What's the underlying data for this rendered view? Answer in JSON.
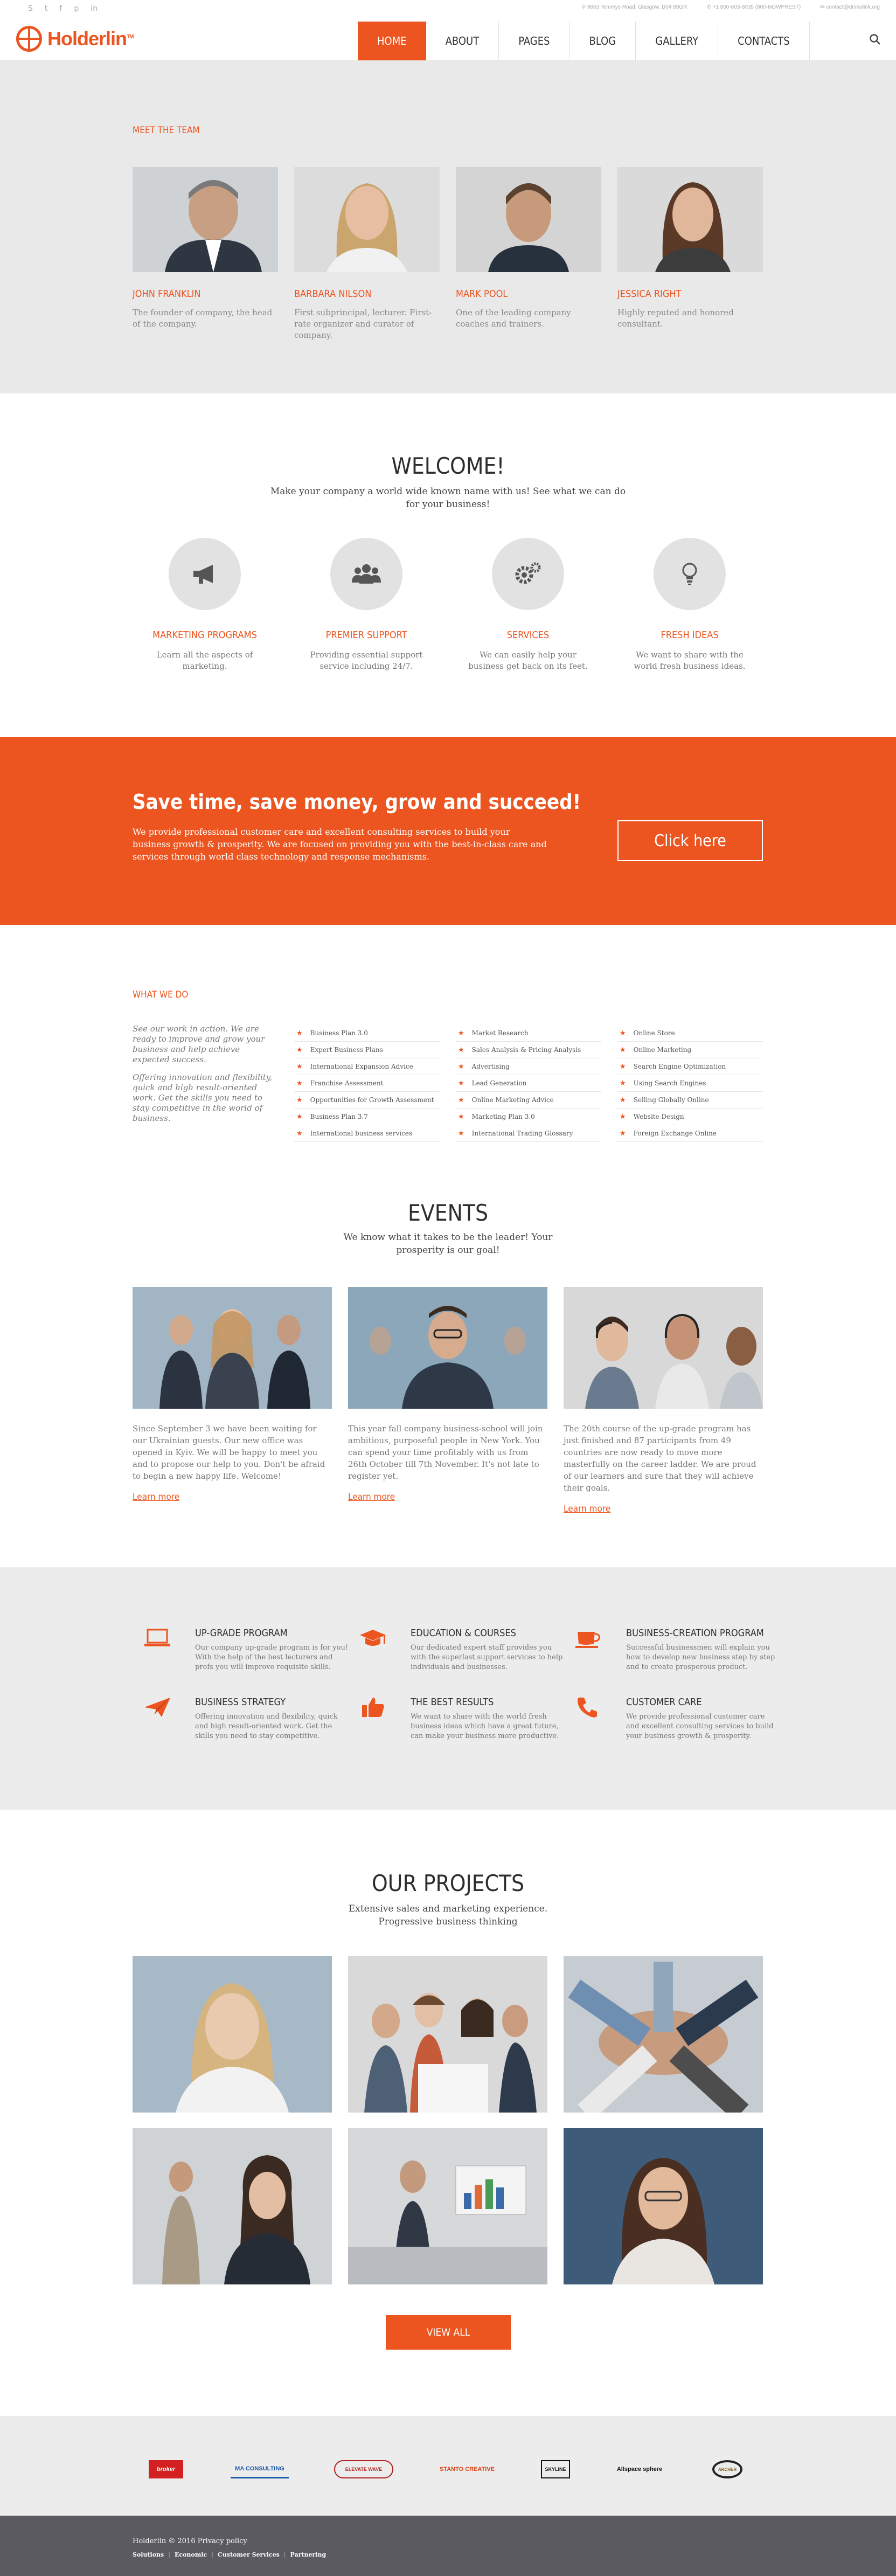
{
  "header": {
    "logo_text": "Holderlin",
    "logo_tm": "TM",
    "social_icons": [
      "skype-icon",
      "twitter-icon",
      "facebook-icon",
      "pinterest-icon",
      "linkedin-icon"
    ],
    "address": "9863 Temmys Road, Glasgow, D04 89GR",
    "phone": "+1 800-603-6035 (800-NOWPREST)",
    "email": "contact@demolink.org",
    "nav": [
      {
        "label": "HOME",
        "active": true
      },
      {
        "label": "ABOUT",
        "active": false
      },
      {
        "label": "PAGES",
        "active": false
      },
      {
        "label": "BLOG",
        "active": false
      },
      {
        "label": "GALLERY",
        "active": false
      },
      {
        "label": "CONTACTS",
        "active": false
      }
    ]
  },
  "team": {
    "label": "MEET THE TEAM",
    "members": [
      {
        "name": "JOHN FRANKLIN",
        "desc": "The founder of company, the head of the company."
      },
      {
        "name": "BARBARA NILSON",
        "desc": "First subprincipal, lecturer. First-rate organizer and curator of company."
      },
      {
        "name": "MARK POOL",
        "desc": "One of the leading company coaches and trainers."
      },
      {
        "name": "JESSICA RIGHT",
        "desc": "Highly reputed and honored consultant."
      }
    ]
  },
  "welcome": {
    "title": "WELCOME!",
    "subtitle": "Make your company a world wide known name with us! See what we can do for your business!",
    "features": [
      {
        "icon": "megaphone-icon",
        "title": "MARKETING PROGRAMS",
        "desc": "Learn all the aspects of marketing."
      },
      {
        "icon": "users-icon",
        "title": "PREMIER SUPPORT",
        "desc": "Providing essential support service including 24/7."
      },
      {
        "icon": "gears-icon",
        "title": "SERVICES",
        "desc": "We can easily help your business get back on its feet."
      },
      {
        "icon": "lightbulb-icon",
        "title": "FRESH IDEAS",
        "desc": "We want to share with the world fresh business ideas."
      }
    ]
  },
  "cta": {
    "title": "Save time, save money, grow and succeed!",
    "text": "We provide professional customer care and excellent consulting services to build your business growth & prosperity. We are focused on providing you with the best-in-class care and services through world class technology and response mechanisms.",
    "button": "Click here"
  },
  "what_we_do": {
    "label": "WHAT WE DO",
    "intro1": "See our work in action. We are ready to improve and grow your business and help achieve expected success.",
    "intro2": "Offering innovation and flexibility, quick and high result-oriented work. Get the skills you need to stay competitive in the world of business.",
    "columns": [
      [
        "Business Plan 3.0",
        "Expert Business Plans",
        "International Expansion Advice",
        "Franchise Assessment",
        "Opportunities for Growth Assessment",
        "Business Plan 3.7",
        "International business services"
      ],
      [
        "Market Research",
        "Sales Analysis & Pricing Analysis",
        "Advertising",
        "Lead Generation",
        "Online Marketing Advice",
        "Marketing Plan 3.0",
        "International Trading Glossary"
      ],
      [
        "Online Store",
        "Online Marketing",
        "Search Engine Optimization",
        "Using Search Engines",
        "Selling Globally Online",
        "Website Design",
        "Foreign Exchange Online"
      ]
    ]
  },
  "events": {
    "title": "EVENTS",
    "subtitle": "We know what it takes to be the leader! Your prosperity is our goal!",
    "items": [
      {
        "text": "Since September 3 we have been waiting for our Ukrainian guests. Our new office was opened in Kyiv. We will be happy to meet you and to propose our help to you. Don't be afraid to begin a new happy life. Welcome!",
        "link": "Learn more"
      },
      {
        "text": "This year fall company business-school will join ambitious, purposeful people in New York. You can spend your time profitably with us from 26th October till 7th November. It's not late to register yet.",
        "link": "Learn more"
      },
      {
        "text": "The 20th course of the up-grade program has just finished and 87 participants from 49 countries are now ready to move more masterfully on the career ladder. We are proud of our learners and sure that they will achieve their goals.",
        "link": "Learn more"
      }
    ]
  },
  "services": [
    {
      "icon": "laptop-icon",
      "title": "UP-GRADE PROGRAM",
      "desc": "Our company up-grade program is for you! With the help of the best lecturers and profs you will improve requisite skills."
    },
    {
      "icon": "graduation-cap-icon",
      "title": "EDUCATION & COURSES",
      "desc": "Our dedicated expert staff provides you with the superlast support services to help individuals and businesses."
    },
    {
      "icon": "coffee-cup-icon",
      "title": "BUSINESS-CREATION PROGRAM",
      "desc": "Successful businessmen will explain you how to develop new business step by step and to create prosperous product."
    },
    {
      "icon": "paper-plane-icon",
      "title": "BUSINESS STRATEGY",
      "desc": "Offering innovation and flexibility, quick and high result-oriented work. Get the skills you need to stay competitive."
    },
    {
      "icon": "thumbs-up-icon",
      "title": "THE BEST RESULTS",
      "desc": "We want to share with the world fresh business ideas which have a great future, can make your business more productive."
    },
    {
      "icon": "phone-icon",
      "title": "CUSTOMER CARE",
      "desc": "We provide professional customer care and excellent consulting services to build your business growth & prosperity."
    }
  ],
  "projects": {
    "title": "OUR PROJECTS",
    "subtitle": "Extensive sales and marketing experience. Progressive business thinking",
    "button": "VIEW ALL"
  },
  "brands": [
    "broker",
    "MA CONSULTING",
    "ELEVATE WAVE",
    "STANTO CREATIVE",
    "SKYLINE",
    "Allspace sphere",
    "ARCHER"
  ],
  "footer": {
    "copyright": "Holderlin © 2016 Privacy policy",
    "links": [
      "Solutions",
      "Economic",
      "Customer Services",
      "Partnering"
    ]
  },
  "colors": {
    "accent": "#ec5420",
    "footer": "#5b5a60",
    "light_gray": "#e9e9e9"
  }
}
